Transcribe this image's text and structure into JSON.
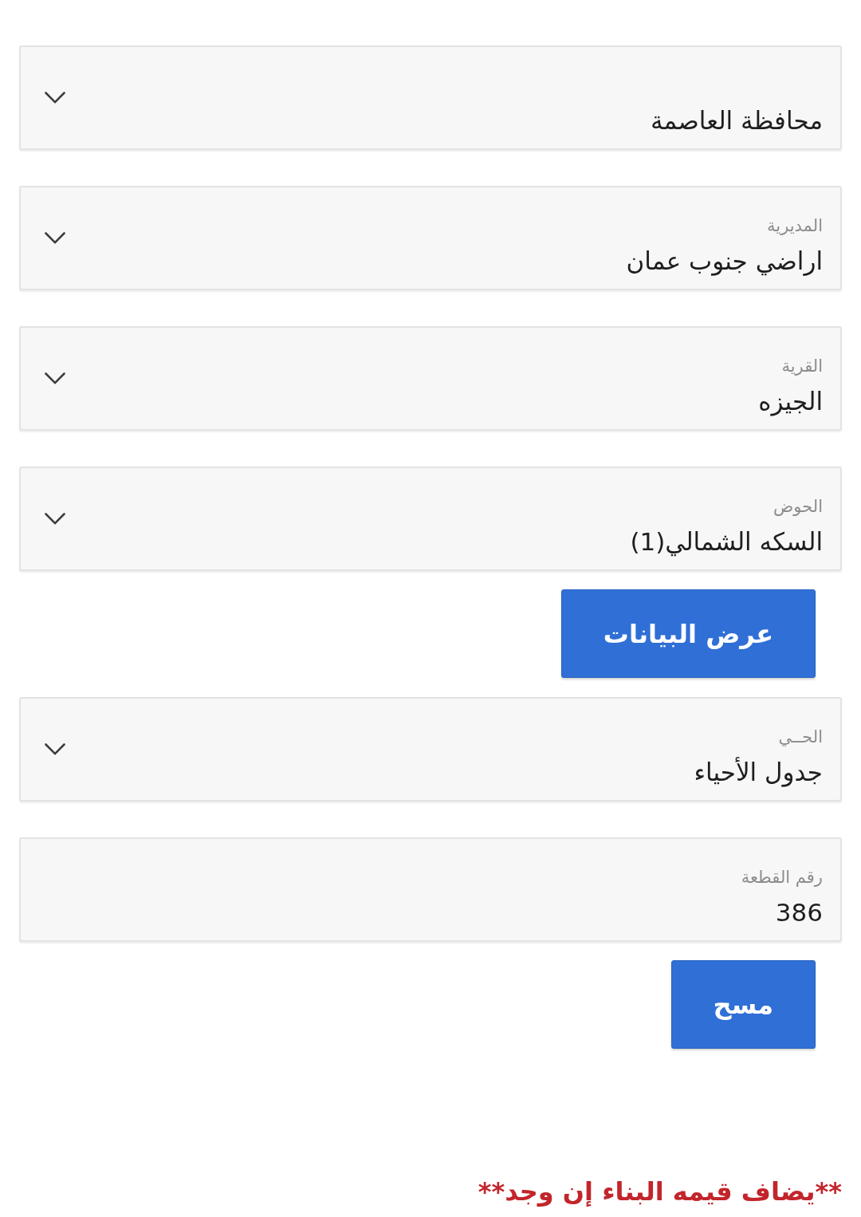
{
  "form": [
    {
      "kind": "select",
      "value": "محافظة العاصمة"
    },
    {
      "kind": "select",
      "label": "المديرية",
      "value": "اراضي جنوب عمان"
    },
    {
      "kind": "select",
      "label": "القرية",
      "value": "الجيزه"
    },
    {
      "kind": "select",
      "label": "الحوض",
      "value": "السكه الشمالي(1)"
    },
    {
      "kind": "button",
      "label": "عرض البيانات"
    },
    {
      "kind": "select",
      "label": "الحــي",
      "value": "جدول الأحياء"
    },
    {
      "kind": "input",
      "label": "رقم القطعة",
      "value": "386"
    },
    {
      "kind": "button",
      "label": "مسح"
    }
  ],
  "note": "**يضاف قيمه البناء إن وجد**"
}
